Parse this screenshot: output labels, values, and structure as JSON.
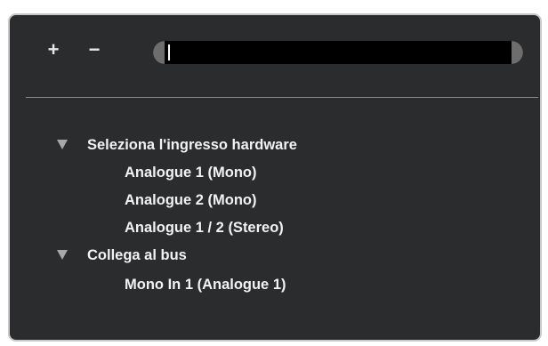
{
  "toolbar": {
    "add_label": "+",
    "remove_label": "−",
    "search_value": ""
  },
  "tree": {
    "groups": [
      {
        "label": "Seleziona l'ingresso hardware",
        "expanded": true,
        "items": [
          {
            "label": "Analogue 1 (Mono)"
          },
          {
            "label": "Analogue 2 (Mono)"
          },
          {
            "label": "Analogue 1 / 2 (Stereo)"
          }
        ]
      },
      {
        "label": "Collega al bus",
        "expanded": true,
        "items": [
          {
            "label": "Mono In 1 (Analogue 1)"
          }
        ]
      }
    ]
  },
  "icons": {
    "expander": "triangle-down-icon",
    "add": "plus-icon",
    "remove": "minus-icon"
  },
  "colors": {
    "panel_background": "#2b2c2e",
    "panel_border": "#c9c9c9",
    "text": "#f2f2f2",
    "search_field": "#000000"
  }
}
